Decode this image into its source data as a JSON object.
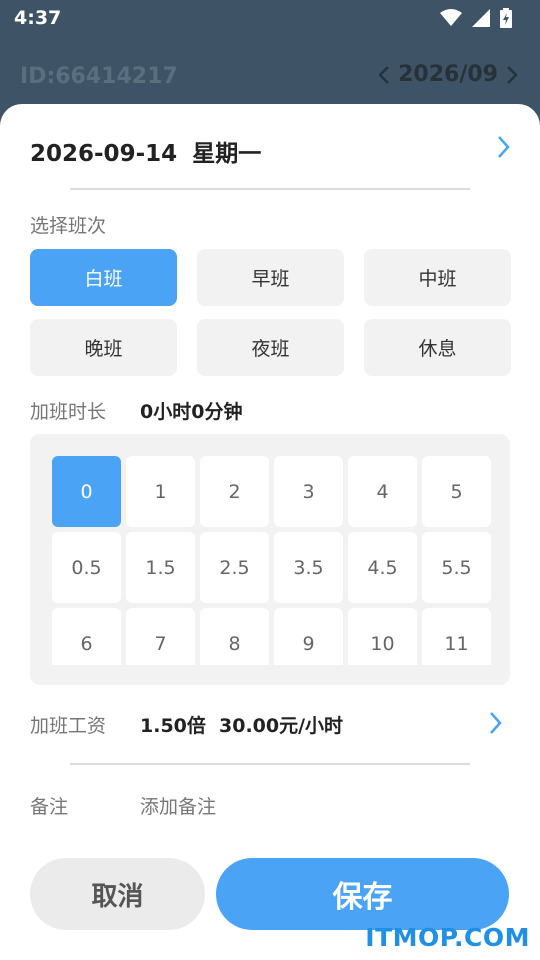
{
  "status_bar": {
    "time": "4:37",
    "icons": [
      "wifi-icon",
      "signal-icon",
      "battery-charging-icon"
    ]
  },
  "header": {
    "user_id": "ID:66414217",
    "month": "2026/09"
  },
  "sheet": {
    "date": "2026-09-14",
    "weekday": "星期一",
    "shift_label": "选择班次",
    "shifts": [
      {
        "label": "白班",
        "selected": true
      },
      {
        "label": "早班",
        "selected": false
      },
      {
        "label": "中班",
        "selected": false
      },
      {
        "label": "晚班",
        "selected": false
      },
      {
        "label": "夜班",
        "selected": false
      },
      {
        "label": "休息",
        "selected": false
      }
    ],
    "overtime_label": "加班时长",
    "overtime_value": "0小时0分钟",
    "hours": [
      "0",
      "1",
      "2",
      "3",
      "4",
      "5",
      "0.5",
      "1.5",
      "2.5",
      "3.5",
      "4.5",
      "5.5",
      "6",
      "7",
      "8",
      "9",
      "10",
      "11"
    ],
    "selected_hour": "0",
    "wage_label": "加班工资",
    "wage_multiplier": "1.50倍",
    "wage_rate": "30.00元/小时",
    "note_label": "备注",
    "note_placeholder": "添加备注",
    "cancel_label": "取消",
    "save_label": "保存"
  },
  "watermark": "ITMOP.COM",
  "colors": {
    "accent": "#4aa3f5",
    "header_bg": "#3e5466",
    "chip_bg": "#f2f2f2"
  }
}
